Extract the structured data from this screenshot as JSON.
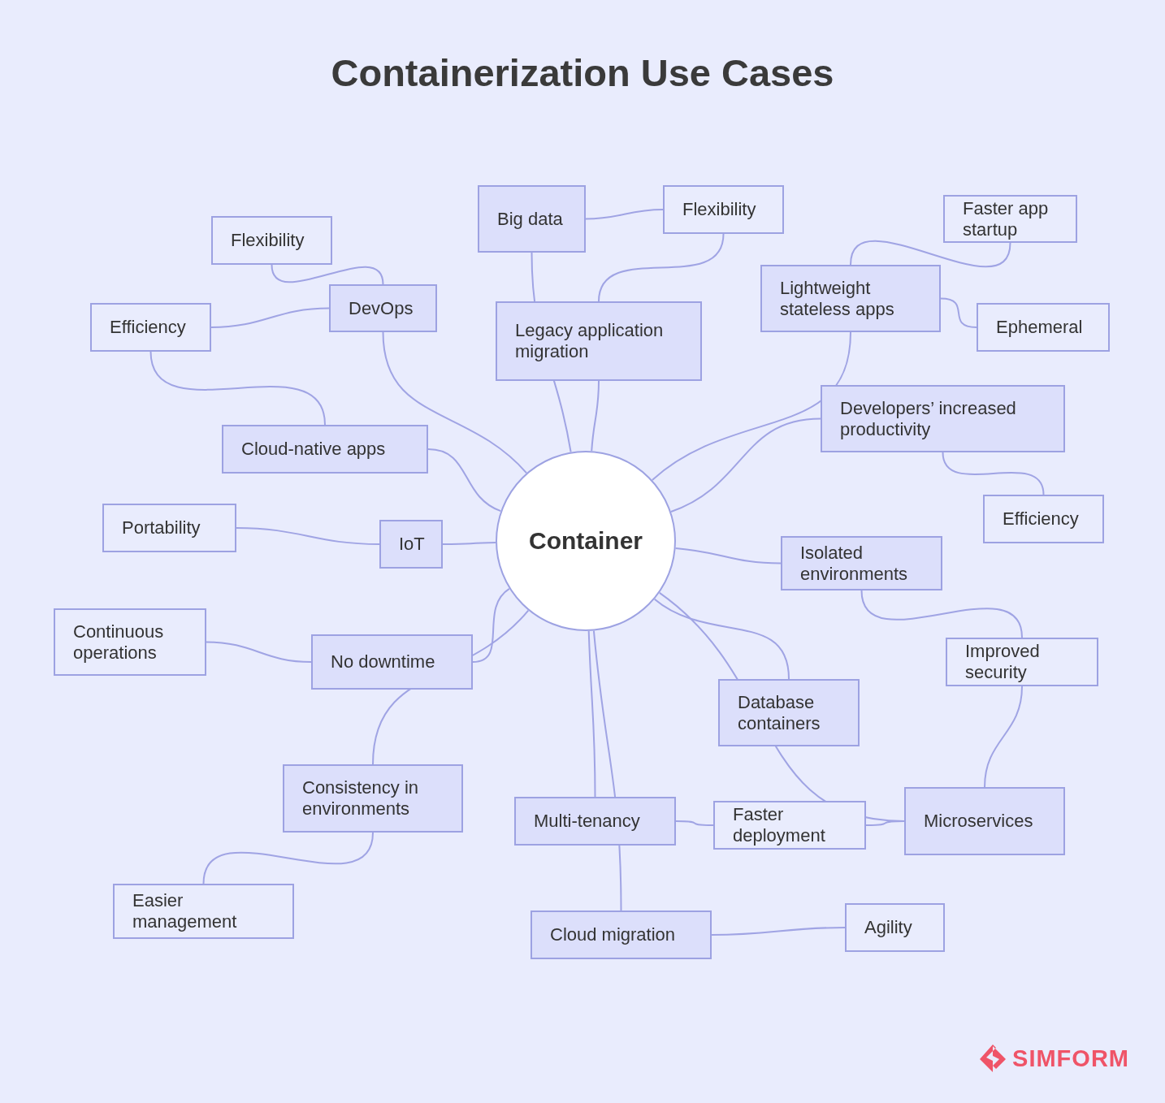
{
  "title": "Containerization Use Cases",
  "center": {
    "label": "Container"
  },
  "nodes": [
    {
      "label": "Big data",
      "kind": "topic"
    },
    {
      "label": "Flexibility",
      "kind": "benefit"
    },
    {
      "label": "Faster app startup",
      "kind": "benefit"
    },
    {
      "label": "Flexibility",
      "kind": "benefit"
    },
    {
      "label": "DevOps",
      "kind": "topic"
    },
    {
      "label": "Lightweight stateless apps",
      "kind": "topic"
    },
    {
      "label": "Efficiency",
      "kind": "benefit"
    },
    {
      "label": "Legacy application migration",
      "kind": "topic"
    },
    {
      "label": "Ephemeral",
      "kind": "benefit"
    },
    {
      "label": "Developers’ increased productivity",
      "kind": "topic"
    },
    {
      "label": "Cloud-native apps",
      "kind": "topic"
    },
    {
      "label": "Portability",
      "kind": "benefit"
    },
    {
      "label": "IoT",
      "kind": "topic"
    },
    {
      "label": "Efficiency",
      "kind": "benefit"
    },
    {
      "label": "Isolated environments",
      "kind": "topic"
    },
    {
      "label": "Continuous operations",
      "kind": "benefit"
    },
    {
      "label": "No downtime",
      "kind": "topic"
    },
    {
      "label": "Improved security",
      "kind": "benefit"
    },
    {
      "label": "Database containers",
      "kind": "topic"
    },
    {
      "label": "Consistency in environments",
      "kind": "topic"
    },
    {
      "label": "Multi-tenancy",
      "kind": "topic"
    },
    {
      "label": "Faster deployment",
      "kind": "benefit"
    },
    {
      "label": "Microservices",
      "kind": "topic"
    },
    {
      "label": "Easier management",
      "kind": "benefit"
    },
    {
      "label": "Cloud migration",
      "kind": "topic"
    },
    {
      "label": "Agility",
      "kind": "benefit"
    }
  ],
  "brand": "SIMFORM"
}
